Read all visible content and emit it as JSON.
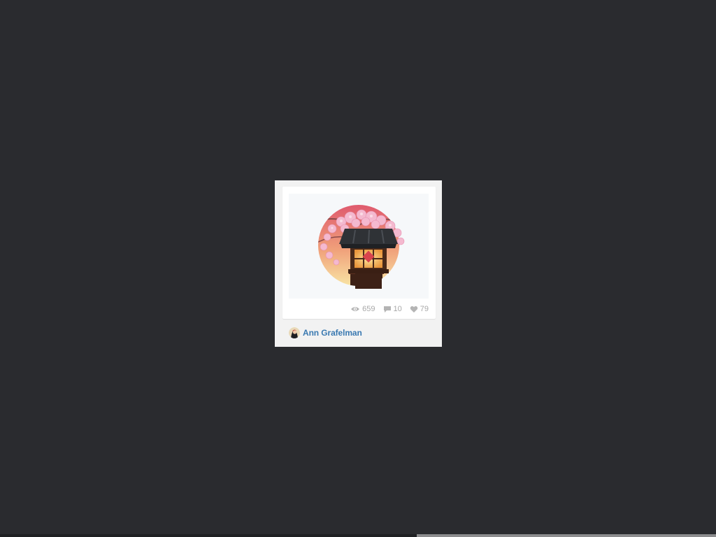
{
  "page": {
    "background": "#2a2b2f"
  },
  "shot": {
    "image_alt": "Japanese lantern with cherry blossoms",
    "accent_colors": {
      "sky_top": "#e0606f",
      "sky_bottom": "#f8e2a0",
      "blossom": "#f4b6cc",
      "roof": "#2f3236",
      "glow": "#f9c86a"
    },
    "stats": {
      "views": "659",
      "comments": "10",
      "likes": "79",
      "views_icon": "eye-icon",
      "comments_icon": "speech-bubble-icon",
      "likes_icon": "heart-icon"
    }
  },
  "author": {
    "name": "Ann Grafelman",
    "link_color": "#3a79b1"
  }
}
